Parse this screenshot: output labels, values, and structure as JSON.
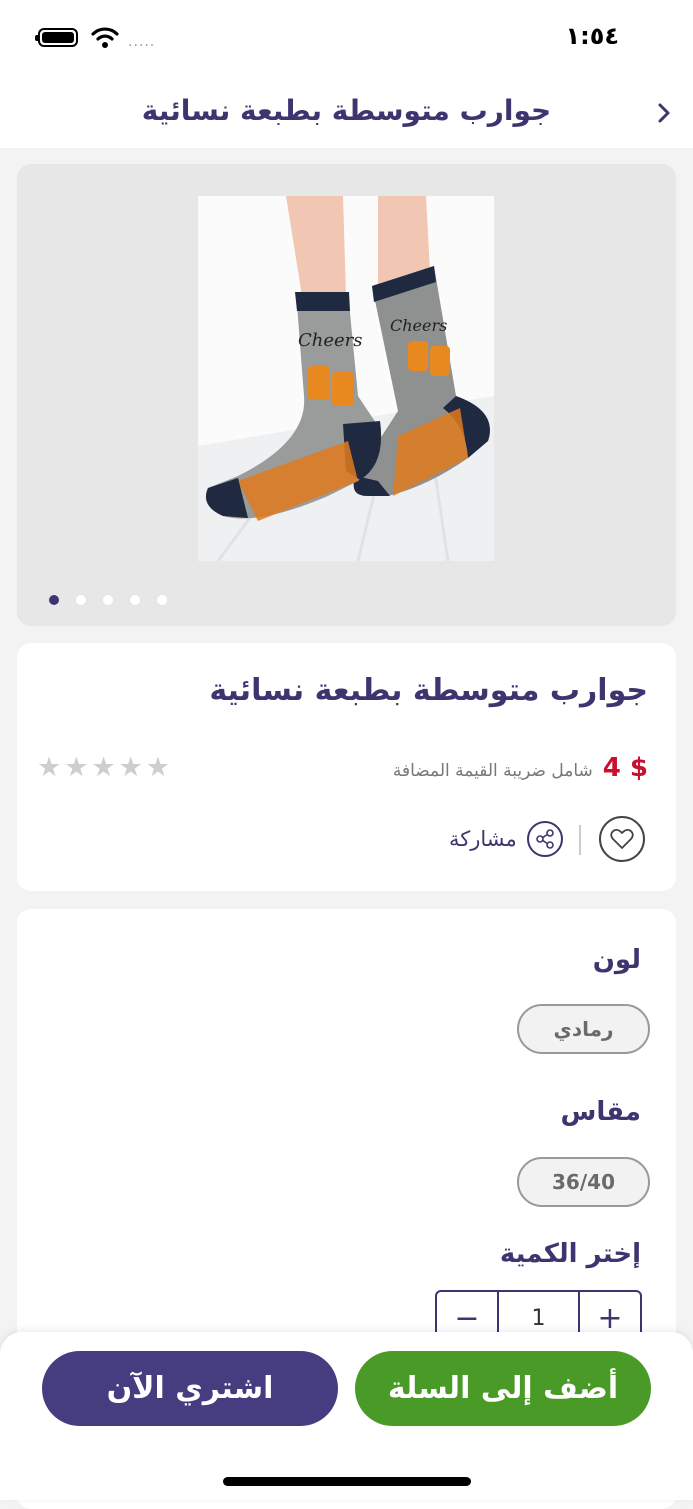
{
  "status_bar": {
    "time": "١:٥٤",
    "signal": "....."
  },
  "nav": {
    "title": "جوارب متوسطة بطبعة نسائية",
    "back_icon": "chevron-right-icon"
  },
  "gallery": {
    "image_alt": "photo of grey socks with Cheers print and orange stripes",
    "pages": 5,
    "active_page": 1
  },
  "product": {
    "title": "جوارب متوسطة بطبعة نسائية",
    "price": "$ 4",
    "tax_note": "شامل ضريبة القيمة المضافة",
    "rating": 0,
    "stars": [
      "★",
      "★",
      "★",
      "★",
      "★"
    ],
    "share_label": "مشاركة"
  },
  "options": {
    "color_label": "لون",
    "color_value": "رمادي",
    "size_label": "مقاس",
    "size_value": "36/40",
    "qty_label": "إختر الكمية",
    "qty_minus": "−",
    "qty_value": "1",
    "qty_plus": "+"
  },
  "actions": {
    "buy_now": "اشتري الآن",
    "add_to_cart": "أضف إلى السلة"
  },
  "colors": {
    "brand_purple": "#3e3570",
    "button_purple": "#463d80",
    "button_green": "#4a9a27",
    "price_red": "#c8102e"
  }
}
